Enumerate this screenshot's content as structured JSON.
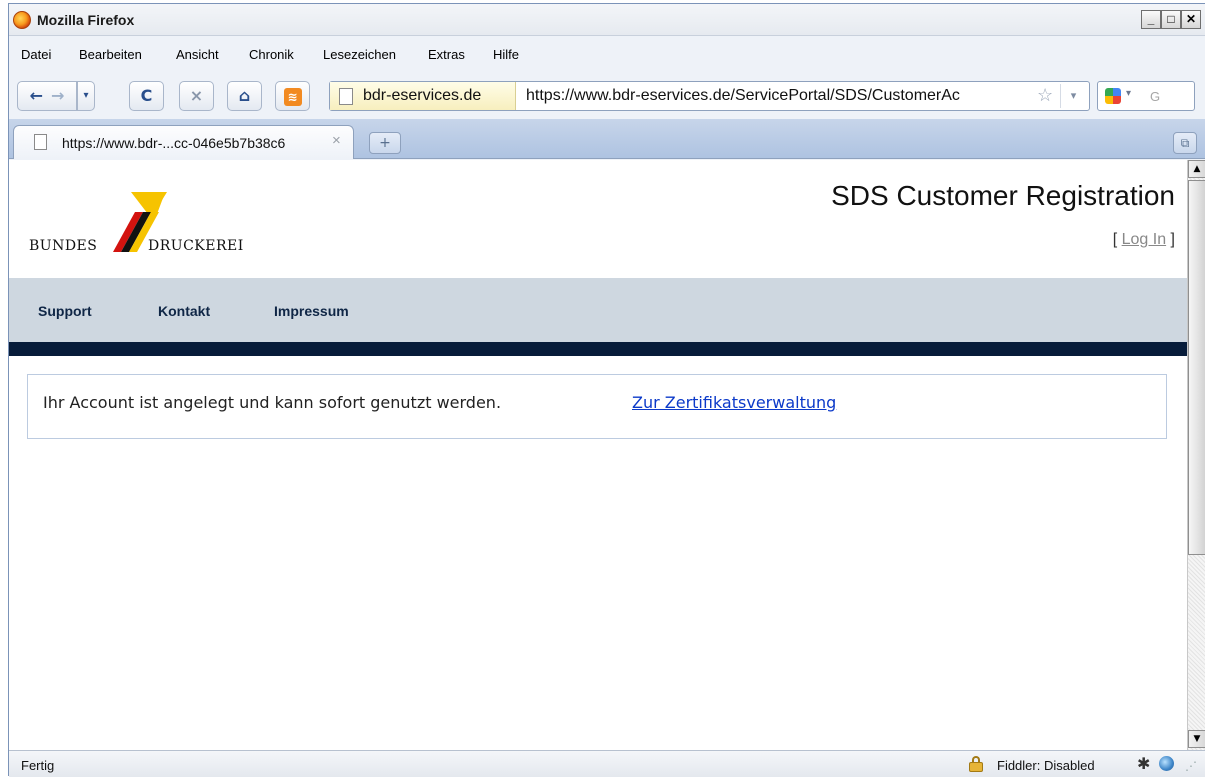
{
  "window": {
    "title": "Mozilla Firefox",
    "controls": {
      "minimize": "_",
      "maximize": "□",
      "close": "✕"
    }
  },
  "menubar": {
    "items": [
      "Datei",
      "Bearbeiten",
      "Ansicht",
      "Chronik",
      "Lesezeichen",
      "Extras",
      "Hilfe"
    ]
  },
  "navigation": {
    "back_icon": "←",
    "forward_icon": "→",
    "history_dropdown_icon": "▾",
    "reload_icon": "C",
    "stop_icon": "×",
    "home_icon": "⌂",
    "feed_icon": "≋",
    "site_identity": "bdr-eservices.de",
    "url": "https://www.bdr-eservices.de/ServicePortal/SDS/CustomerAc",
    "star_icon": "☆",
    "url_dropdown_icon": "▾",
    "search_placeholder": "G",
    "search_dropdown_icon": "▾"
  },
  "tabs": {
    "active_title": "https://www.bdr-...cc-046e5b7b38c6",
    "close_icon": "×",
    "new_tab_icon": "+",
    "list_icon": "⧉"
  },
  "page": {
    "logo_left": "BUNDES",
    "logo_right": "DRUCKEREI",
    "heading": "SDS Customer Registration",
    "login_open": "[ ",
    "login_link": "Log In",
    "login_close": " ]",
    "nav": [
      "Support",
      "Kontakt",
      "Impressum"
    ],
    "notice_text": "Ihr Account ist angelegt und kann sofort genutzt werden.",
    "notice_link": "Zur Zertifikatsverwaltung"
  },
  "scrollbar": {
    "up_icon": "▲",
    "down_icon": "▼"
  },
  "statusbar": {
    "status": "Fertig",
    "fiddler": "Fiddler: Disabled",
    "fiddler_icon": "✱",
    "grip_icon": "⋰"
  },
  "colors": {
    "nav_band": "#ced7e0",
    "dark_band": "#071c3a",
    "link": "#0b39c9",
    "logo_yellow": "#f6c300",
    "logo_red": "#d3130f"
  }
}
